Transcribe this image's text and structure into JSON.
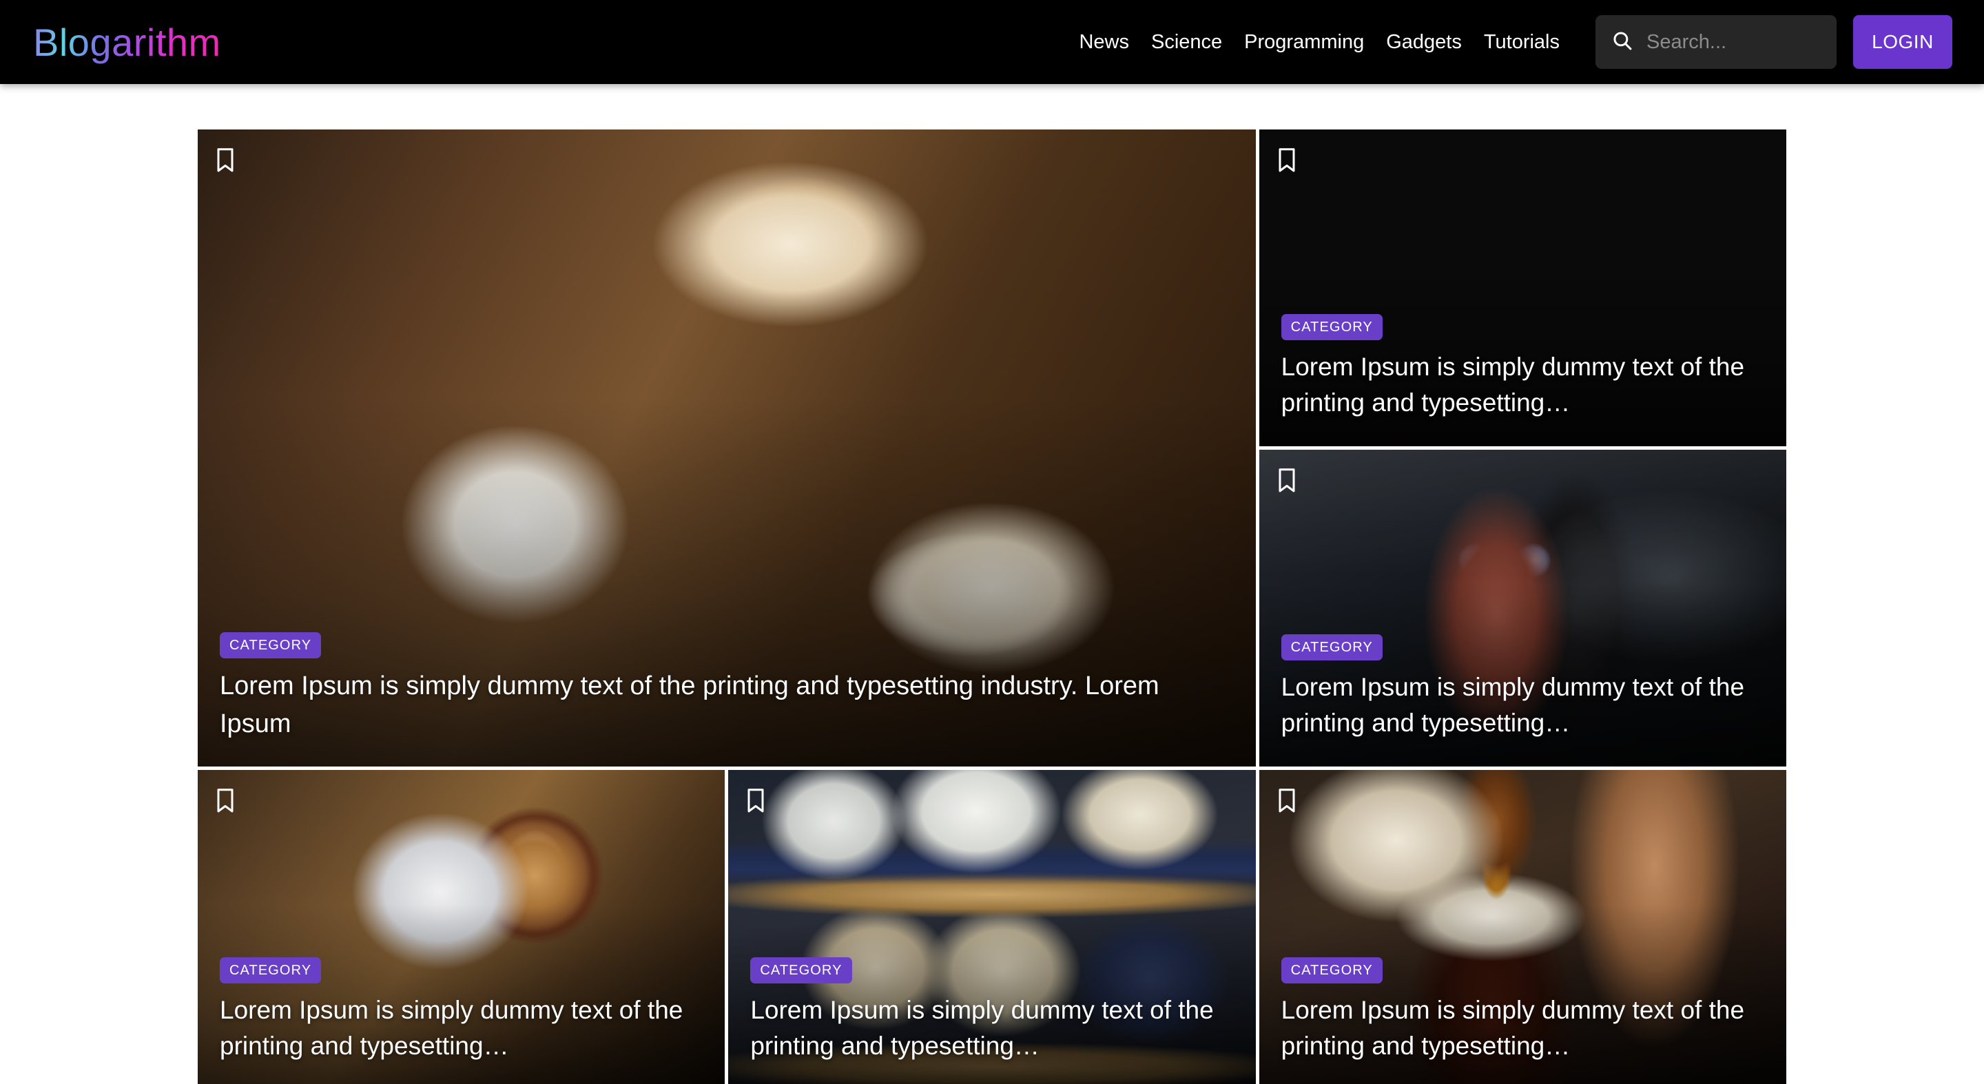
{
  "header": {
    "brand": "Blogarithm",
    "nav": [
      {
        "label": "News"
      },
      {
        "label": "Science"
      },
      {
        "label": "Programming"
      },
      {
        "label": "Gadgets"
      },
      {
        "label": "Tutorials"
      }
    ],
    "search": {
      "placeholder": "Search...",
      "value": "",
      "icon": "search-icon"
    },
    "login_label": "LOGIN"
  },
  "theme": {
    "header_bg": "#000000",
    "page_bg": "#ffffff",
    "accent_purple": "#6a35cc",
    "badge_purple": "#6a3fc8",
    "text_on_dark": "#ffffff",
    "search_bg": "#262626",
    "placeholder_color": "#8c8c8c"
  },
  "cards": [
    {
      "id": "hero",
      "badge": "CATEGORY",
      "title": "Lorem Ipsum is simply dummy text of the printing and typesetting industry. Lorem Ipsum",
      "bookmark_icon": "bookmark-icon",
      "image_alt": "breakfast-plate-coffee"
    },
    {
      "id": "burger",
      "badge": "CATEGORY",
      "title": "Lorem Ipsum is simply dummy text of the printing and typesetting…",
      "bookmark_icon": "bookmark-icon",
      "image_alt": "burger-and-fries"
    },
    {
      "id": "camera",
      "badge": "CATEGORY",
      "title": "Lorem Ipsum is simply dummy text of the printing and typesetting…",
      "bookmark_icon": "bookmark-icon",
      "image_alt": "vintage-kodak-camera"
    },
    {
      "id": "latte",
      "badge": "CATEGORY",
      "title": "Lorem Ipsum is simply dummy text of the printing and typesetting…",
      "bookmark_icon": "bookmark-icon",
      "image_alt": "latte-art-and-laptop"
    },
    {
      "id": "hats",
      "badge": "CATEGORY",
      "title": "Lorem Ipsum is simply dummy text of the printing and typesetting…",
      "bookmark_icon": "bookmark-icon",
      "image_alt": "panama-hats-on-shelf"
    },
    {
      "id": "honey",
      "badge": "CATEGORY",
      "title": "Lorem Ipsum is simply dummy text of the printing and typesetting…",
      "bookmark_icon": "bookmark-icon",
      "image_alt": "honey-dipper-over-jar"
    }
  ]
}
